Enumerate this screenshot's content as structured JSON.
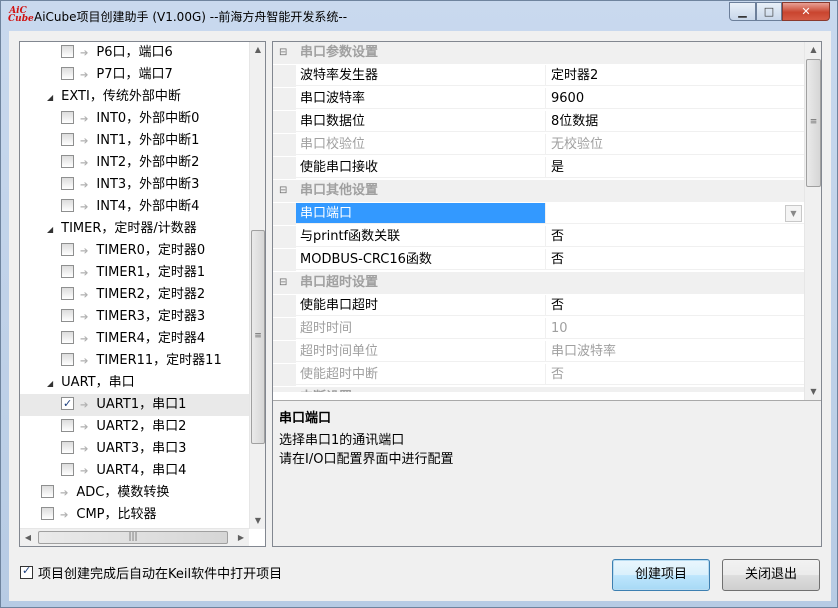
{
  "window": {
    "title": "AiCube项目创建助手 (V1.00G) --前海方舟智能开发系统--",
    "icon_text_top": "AiC",
    "icon_text_bottom": "Cube",
    "min_glyph": "▁",
    "max_glyph": "□",
    "close_glyph": "✕"
  },
  "tree": {
    "items": [
      {
        "kind": "leaf",
        "label": "P6口，端口6",
        "checked": false
      },
      {
        "kind": "leaf",
        "label": "P7口，端口7",
        "checked": false
      },
      {
        "kind": "group",
        "label": "EXTI，传统外部中断"
      },
      {
        "kind": "leaf",
        "label": "INT0，外部中断0",
        "checked": false
      },
      {
        "kind": "leaf",
        "label": "INT1，外部中断1",
        "checked": false
      },
      {
        "kind": "leaf",
        "label": "INT2，外部中断2",
        "checked": false
      },
      {
        "kind": "leaf",
        "label": "INT3，外部中断3",
        "checked": false
      },
      {
        "kind": "leaf",
        "label": "INT4，外部中断4",
        "checked": false
      },
      {
        "kind": "group",
        "label": "TIMER，定时器/计数器"
      },
      {
        "kind": "leaf",
        "label": "TIMER0，定时器0",
        "checked": false
      },
      {
        "kind": "leaf",
        "label": "TIMER1，定时器1",
        "checked": false
      },
      {
        "kind": "leaf",
        "label": "TIMER2，定时器2",
        "checked": false
      },
      {
        "kind": "leaf",
        "label": "TIMER3，定时器3",
        "checked": false
      },
      {
        "kind": "leaf",
        "label": "TIMER4，定时器4",
        "checked": false
      },
      {
        "kind": "leaf",
        "label": "TIMER11，定时器11",
        "checked": false
      },
      {
        "kind": "group",
        "label": "UART，串口"
      },
      {
        "kind": "leaf",
        "label": "UART1，串口1",
        "checked": true,
        "selected": true
      },
      {
        "kind": "leaf",
        "label": "UART2，串口2",
        "checked": false
      },
      {
        "kind": "leaf",
        "label": "UART3，串口3",
        "checked": false
      },
      {
        "kind": "leaf",
        "label": "UART4，串口4",
        "checked": false
      },
      {
        "kind": "top",
        "label": "ADC，模数转换",
        "checked": false
      },
      {
        "kind": "top",
        "label": "CMP，比较器",
        "checked": false
      }
    ]
  },
  "properties": {
    "categories": [
      {
        "label": "串口参数设置",
        "rows": [
          {
            "name": "波特率发生器",
            "value": "定时器2",
            "disabled": false
          },
          {
            "name": "串口波特率",
            "value": "9600",
            "disabled": false
          },
          {
            "name": "串口数据位",
            "value": "8位数据",
            "disabled": false
          },
          {
            "name": "串口校验位",
            "value": "无校验位",
            "disabled": true
          },
          {
            "name": "使能串口接收",
            "value": "是",
            "disabled": false
          }
        ]
      },
      {
        "label": "串口其他设置",
        "rows": [
          {
            "name": "串口端口",
            "value": "",
            "disabled": false,
            "selected": true,
            "dropdown": true
          },
          {
            "name": "与printf函数关联",
            "value": "否",
            "disabled": false
          },
          {
            "name": "MODBUS-CRC16函数",
            "value": "否",
            "disabled": false
          }
        ]
      },
      {
        "label": "串口超时设置",
        "rows": [
          {
            "name": "使能串口超时",
            "value": "否",
            "disabled": false
          },
          {
            "name": "超时时间",
            "value": "10",
            "disabled": true
          },
          {
            "name": "超时时间单位",
            "value": "串口波特率",
            "disabled": true
          },
          {
            "name": "使能超时中断",
            "value": "否",
            "disabled": true
          }
        ]
      },
      {
        "label": "中断设置",
        "rows": []
      }
    ]
  },
  "description": {
    "title": "串口端口",
    "lines": [
      "选择串口1的通讯端口",
      "请在I/O口配置界面中进行配置"
    ]
  },
  "footer": {
    "auto_open_label": "项目创建完成后自动在Keil软件中打开项目",
    "auto_open_checked": true,
    "create_button": "创建项目",
    "close_button": "关闭退出"
  }
}
